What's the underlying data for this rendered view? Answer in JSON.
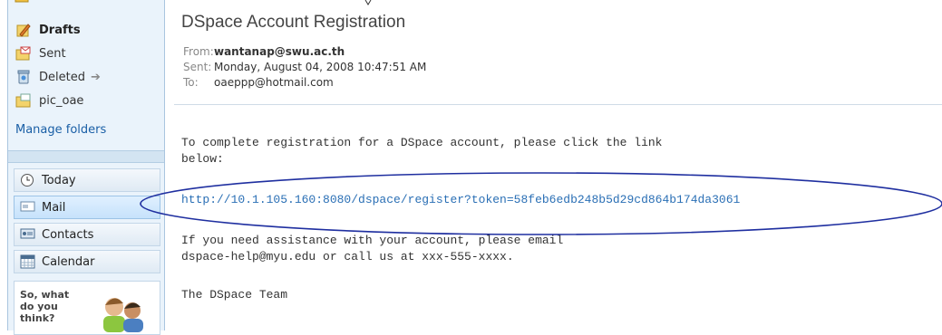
{
  "folders": [
    {
      "label": "Drafts",
      "icon": "drafts-icon",
      "bold": true
    },
    {
      "label": "Sent",
      "icon": "sent-folder-icon",
      "bold": false
    },
    {
      "label": "Deleted",
      "icon": "deleted-folder-icon",
      "bold": false
    },
    {
      "label": "pic_oae",
      "icon": "folder-icon",
      "bold": false
    }
  ],
  "manage_folders": "Manage folders",
  "nav": [
    {
      "label": "Today",
      "icon": "clock-icon"
    },
    {
      "label": "Mail",
      "icon": "mail-icon",
      "active": true
    },
    {
      "label": "Contacts",
      "icon": "contacts-icon"
    },
    {
      "label": "Calendar",
      "icon": "calendar-icon"
    }
  ],
  "feedback": {
    "question": "So, what do you think?"
  },
  "message": {
    "subject": "DSpace Account Registration",
    "from_label": "From:",
    "from": "wantanap@swu.ac.th",
    "sent_label": "Sent:",
    "sent": "Monday, August 04, 2008 10:47:51 AM",
    "to_label": "To:",
    "to": "oaeppp@hotmail.com",
    "body_line1": "To complete registration for a DSpace account, please click the link",
    "body_line2": "below:",
    "link": "http://10.1.105.160:8080/dspace/register?token=58feb6edb248b5d29cd864b174da3061",
    "assist_line1": "If you need assistance with your account, please email",
    "assist_line2": "dspace-help@myu.edu or call us at xxx-555-xxxx.",
    "signature": "The DSpace Team"
  },
  "colors": {
    "link": "#2a6fb5",
    "ellipse": "#1f2fa0",
    "sidebar_bg": "#eaf3fb"
  }
}
